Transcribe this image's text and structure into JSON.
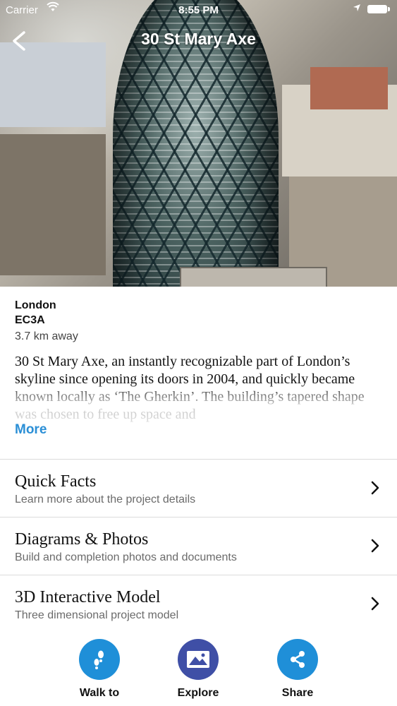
{
  "status_bar": {
    "carrier": "Carrier",
    "time": "8:55 PM"
  },
  "nav": {
    "title": "30 St Mary Axe"
  },
  "location": {
    "city": "London",
    "postcode": "EC3A",
    "distance": "3.7 km away"
  },
  "description": {
    "text": "30 St Mary Axe, an instantly recognizable part of London’s skyline since opening its doors in 2004, and quickly became known locally as ‘The Gherkin’. The building’s tapered shape was chosen to free up space and",
    "more_label": "More"
  },
  "menu": [
    {
      "title": "Quick Facts",
      "subtitle": "Learn more about the project details"
    },
    {
      "title": "Diagrams & Photos",
      "subtitle": "Build and completion photos and documents"
    },
    {
      "title": "3D Interactive Model",
      "subtitle": "Three dimensional project model"
    }
  ],
  "actions": [
    {
      "label": "Walk to",
      "color": "#1f8fd8",
      "icon": "walk-icon"
    },
    {
      "label": "Explore",
      "color": "#3f4fa6",
      "icon": "mountains-icon"
    },
    {
      "label": "Share",
      "color": "#1f8fd8",
      "icon": "share-icon"
    }
  ]
}
